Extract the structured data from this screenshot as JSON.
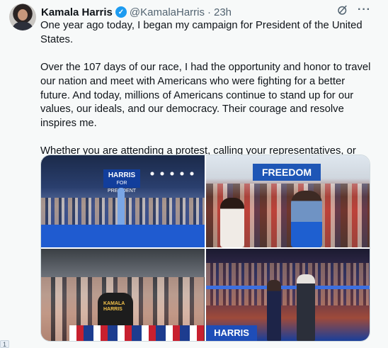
{
  "tweet": {
    "author_name": "Kamala Harris",
    "handle": "@KamalaHarris",
    "separator": "·",
    "time": "23h",
    "more_label": "···",
    "paragraphs": [
      "One year ago today, I began my campaign for President of the United States.",
      "Over the 107 days of our race, I had the opportunity and honor to travel our nation and meet with Americans who were fighting for a better future. And today, millions of Americans continue to stand up for our values, our ideals, and our democracy. Their courage and resolve inspires me.",
      "Whether you are attending a protest, calling your representatives, or building community, I want to say: Thank you. We are in this fight together."
    ]
  },
  "media": {
    "photo1_sign": "HARRIS",
    "photo1_sign_sub": "FOR PRESIDENT",
    "photo2_sign": "FREEDOM",
    "photo3_shirt": "KAMALA HARRIS",
    "photo4_banner": "HARRIS"
  },
  "edge_badge": "1",
  "colors": {
    "verified": "#1d9bf0",
    "text": "#0f1419",
    "secondary": "#536471",
    "background": "#f7f9f9"
  },
  "icons": {
    "verified": "verified-badge-icon",
    "grok": "grok-icon",
    "more": "more-icon"
  }
}
